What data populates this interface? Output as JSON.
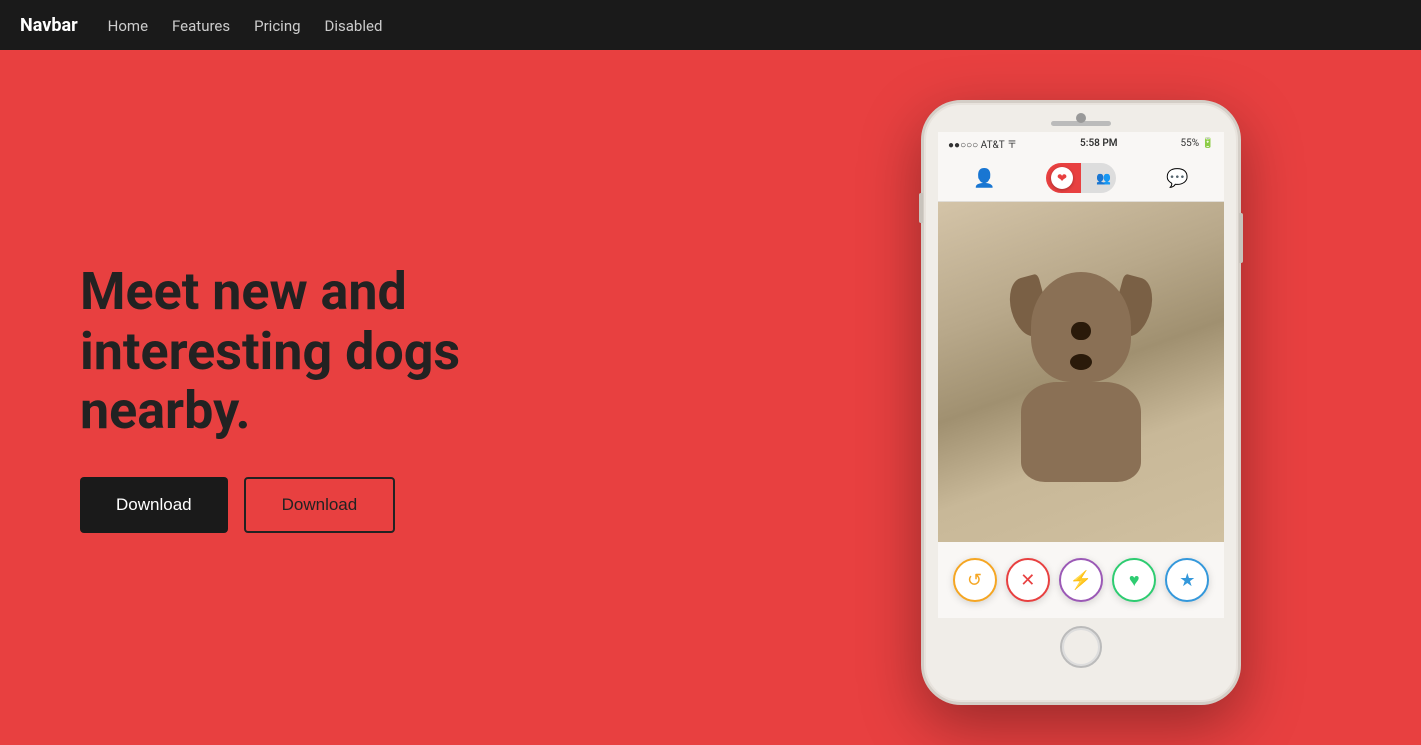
{
  "navbar": {
    "brand": "Navbar",
    "links": [
      {
        "label": "Home",
        "id": "home"
      },
      {
        "label": "Features",
        "id": "features"
      },
      {
        "label": "Pricing",
        "id": "pricing"
      },
      {
        "label": "Disabled",
        "id": "disabled"
      }
    ]
  },
  "hero": {
    "title": "Meet new and interesting dogs nearby.",
    "button_primary": "Download",
    "button_secondary": "Download",
    "background_color": "#e84040"
  },
  "phone": {
    "status_bar": {
      "left": "●●○○○ AT&T 〒",
      "center": "5:58 PM",
      "right": "⊕ ▲ ✱ ⬛ 55% 🔋"
    },
    "action_buttons": [
      {
        "icon": "↺",
        "type": "undo",
        "color": "#f5a623"
      },
      {
        "icon": "✕",
        "type": "nope",
        "color": "#e84040"
      },
      {
        "icon": "⚡",
        "type": "boost",
        "color": "#9b59b6"
      },
      {
        "icon": "♥",
        "type": "like",
        "color": "#2ecc71"
      },
      {
        "icon": "★",
        "type": "star",
        "color": "#3498db"
      }
    ]
  }
}
